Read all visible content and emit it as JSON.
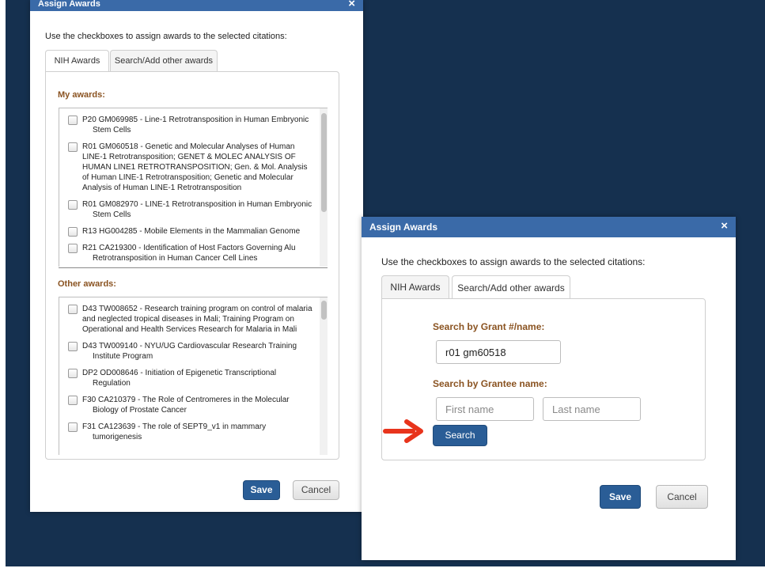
{
  "colors": {
    "backdrop": "#15304f",
    "titlebar": "#3a6aa8",
    "primary_button": "#2a5d96",
    "section_heading": "#8a5321",
    "annotation_arrow": "#e8341c"
  },
  "dialog_back": {
    "title": "Assign Awards",
    "close_icon": "×",
    "instructions": "Use the checkboxes to assign awards to the selected citations:",
    "tabs": [
      {
        "label": "NIH Awards",
        "active": true
      },
      {
        "label": "Search/Add other awards",
        "active": false
      }
    ],
    "my_awards": {
      "heading": "My awards:",
      "items": [
        {
          "text": "P20 GM069985 - Line-1 Retrotransposition in Human Embryonic Stem Cells",
          "checked": false
        },
        {
          "text": "R01 GM060518 - Genetic and Molecular Analyses of Human LINE-1 Retrotransposition; GENET & MOLEC ANALYSIS OF HUMAN LINE1 RETROTRANSPOSITION; Gen. & Mol. Analysis of Human LINE-1 Retrotransposition; Genetic and Molecular Analysis of Human LINE-1 Retrotransposition",
          "checked": false
        },
        {
          "text": "R01 GM082970 - LINE-1 Retrotransposition in Human Embryonic Stem Cells",
          "checked": false
        },
        {
          "text": "R13 HG004285 - Mobile Elements in the Mammalian Genome",
          "checked": false
        },
        {
          "text": "R21 CA219300 - Identification of Host Factors Governing Alu Retrotransposition in Human Cancer Cell Lines",
          "checked": false
        }
      ]
    },
    "other_awards": {
      "heading": "Other awards:",
      "items": [
        {
          "text": "D43 TW008652 - Research training program on control of malaria and neglected tropical diseases in Mali; Training Program on Operational and Health Services Research for Malaria in Mali",
          "checked": false
        },
        {
          "text": "D43 TW009140 - NYU/UG Cardiovascular Research Training Institute Program",
          "checked": false
        },
        {
          "text": "DP2 OD008646 - Initiation of Epigenetic Transcriptional Regulation",
          "checked": false
        },
        {
          "text": "F30 CA210379 - The Role of Centromeres in the Molecular Biology of Prostate Cancer",
          "checked": false
        },
        {
          "text": "F31 CA123639 - The role of SEPT9_v1 in mammary tumorigenesis",
          "checked": false
        }
      ]
    },
    "save_label": "Save",
    "cancel_label": "Cancel"
  },
  "dialog_front": {
    "title": "Assign Awards",
    "close_icon": "×",
    "instructions": "Use the checkboxes to assign awards to the selected citations:",
    "tabs": [
      {
        "label": "NIH Awards",
        "active": false
      },
      {
        "label": "Search/Add other awards",
        "active": true
      }
    ],
    "search": {
      "grant_label": "Search by Grant #/name:",
      "grant_value": "r01 gm60518",
      "grantee_label": "Search by Grantee name:",
      "first_name_placeholder": "First name",
      "last_name_placeholder": "Last name",
      "search_button": "Search"
    },
    "save_label": "Save",
    "cancel_label": "Cancel"
  }
}
